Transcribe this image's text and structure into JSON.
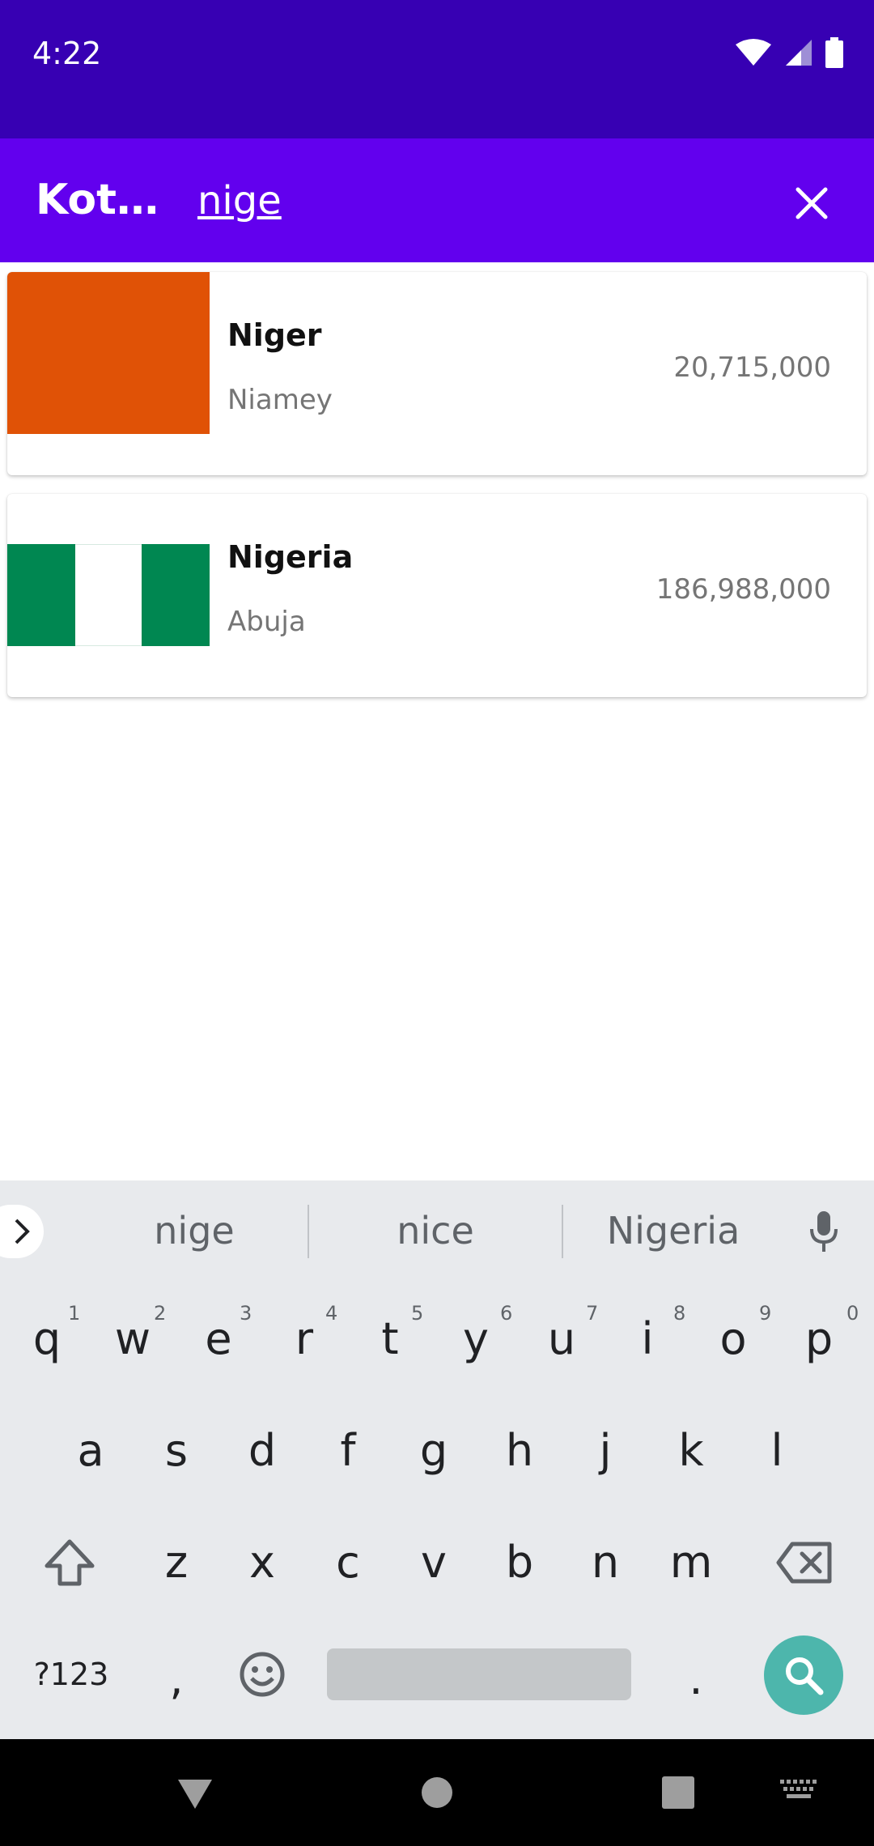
{
  "status_bar": {
    "time": "4:22"
  },
  "app_bar": {
    "title": "Kot…",
    "search_value": "nige"
  },
  "results": [
    {
      "name": "Niger",
      "capital": "Niamey",
      "population": "20,715,000"
    },
    {
      "name": "Nigeria",
      "capital": "Abuja",
      "population": "186,988,000"
    }
  ],
  "keyboard": {
    "suggestions": [
      "nige",
      "nice",
      "Nigeria"
    ],
    "row1": [
      "q",
      "w",
      "e",
      "r",
      "t",
      "y",
      "u",
      "i",
      "o",
      "p"
    ],
    "row1_nums": [
      "1",
      "2",
      "3",
      "4",
      "5",
      "6",
      "7",
      "8",
      "9",
      "0"
    ],
    "row2": [
      "a",
      "s",
      "d",
      "f",
      "g",
      "h",
      "j",
      "k",
      "l"
    ],
    "row3": [
      "z",
      "x",
      "c",
      "v",
      "b",
      "n",
      "m"
    ],
    "symbols_label": "?123",
    "comma": ",",
    "period": "."
  },
  "colors": {
    "status_bar": "#3700B3",
    "app_bar": "#6200EE",
    "niger_flag": "#E05206",
    "nigeria_green": "#008751",
    "search_fab": "#4DB6AC"
  }
}
